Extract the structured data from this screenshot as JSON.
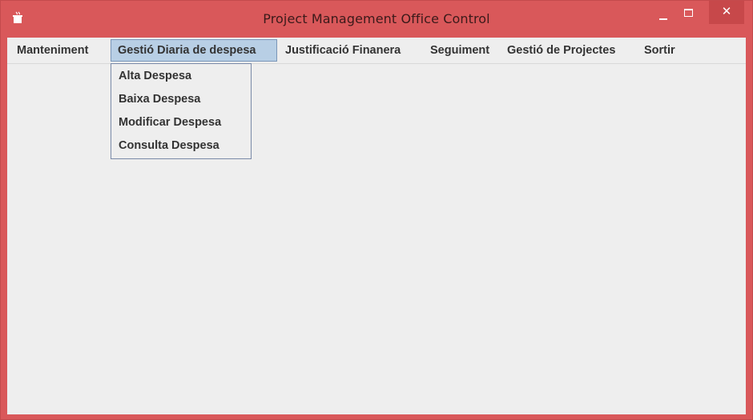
{
  "window": {
    "title": "Project Management Office Control",
    "close_symbol": "✕",
    "colors": {
      "frame": "#d9585a",
      "close_button": "#c7484a",
      "client_background": "#eeeeee",
      "active_menu": "#b8cfe5"
    }
  },
  "menubar": {
    "items": [
      {
        "label": "Manteniment"
      },
      {
        "label": "Gestió Diaria de despesa",
        "active": true
      },
      {
        "label": "Justificació Finanera"
      },
      {
        "label": "Seguiment"
      },
      {
        "label": "Gestió de Projectes"
      },
      {
        "label": "Sortir"
      }
    ]
  },
  "dropdown": {
    "items": [
      {
        "label": "Alta Despesa"
      },
      {
        "label": "Baixa Despesa"
      },
      {
        "label": "Modificar Despesa"
      },
      {
        "label": "Consulta Despesa"
      }
    ]
  },
  "icons": {
    "app": "java-coffee-cup-icon",
    "minimize": "minimize-icon",
    "maximize": "maximize-icon",
    "close": "close-icon"
  }
}
